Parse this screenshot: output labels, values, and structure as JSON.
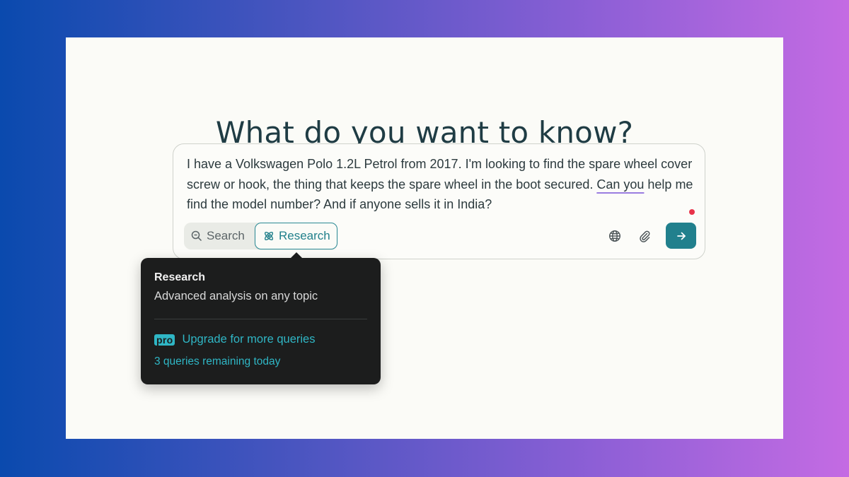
{
  "page": {
    "headline": "What do you want to know?"
  },
  "query": {
    "text_before": "I have a Volkswagen Polo 1.2L Petrol from 2017. I'm looking to find the spare wheel cover screw or hook, the thing that keeps the spare wheel in the boot secured. ",
    "text_underlined": "Can you",
    "text_after": " help me find the model number? And if anyone sells it in India?"
  },
  "modes": {
    "search_label": "Search",
    "research_label": "Research",
    "selected": "Research",
    "search_icon": "search-icon",
    "research_icon": "research-icon"
  },
  "tools": {
    "globe_icon": "globe-icon",
    "attach_icon": "paperclip-icon",
    "submit_icon": "arrow-right-icon"
  },
  "tooltip": {
    "title": "Research",
    "description": "Advanced analysis on any topic",
    "pro_badge": "pro",
    "upgrade_link": "Upgrade for more queries",
    "remaining": "3 queries remaining today"
  },
  "colors": {
    "accent": "#21808d",
    "link": "#2fb6c5",
    "tooltip_bg": "#1c1d1d",
    "caret_dot": "#e8334a",
    "underline": "#9a7ce0"
  }
}
